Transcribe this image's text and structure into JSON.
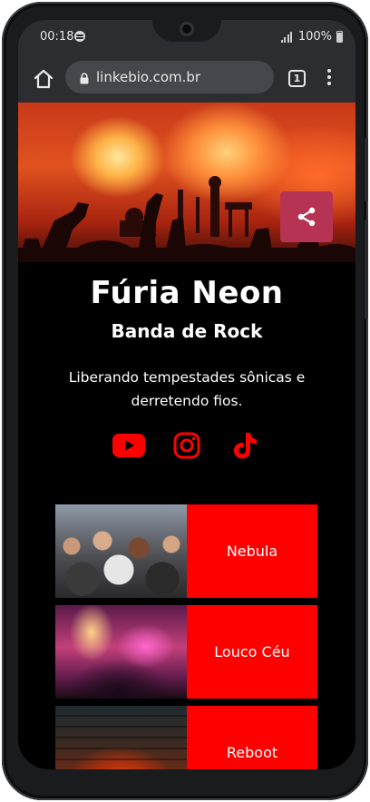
{
  "status_bar": {
    "time": "00:18",
    "battery": "100%"
  },
  "browser": {
    "url": "linkebio.com.br",
    "tab_count": "1"
  },
  "profile": {
    "name": "Fúria Neon",
    "subtitle": "Banda de Rock",
    "bio": "Liberando tempestades sônicas e derretendo fios."
  },
  "socials": [
    {
      "icon": "youtube-icon"
    },
    {
      "icon": "instagram-icon"
    },
    {
      "icon": "tiktok-icon"
    }
  ],
  "links": [
    {
      "label": "Nebula",
      "thumb": "crowd-photo"
    },
    {
      "label": "Louco Céu",
      "thumb": "stage-lights-photo"
    },
    {
      "label": "Reboot",
      "thumb": "stage-tunnel-photo"
    }
  ],
  "colors": {
    "accent_red": "#ff0000",
    "share_button": "#b63354",
    "browser_bar": "#2b2d31",
    "page_bg": "#000000"
  }
}
